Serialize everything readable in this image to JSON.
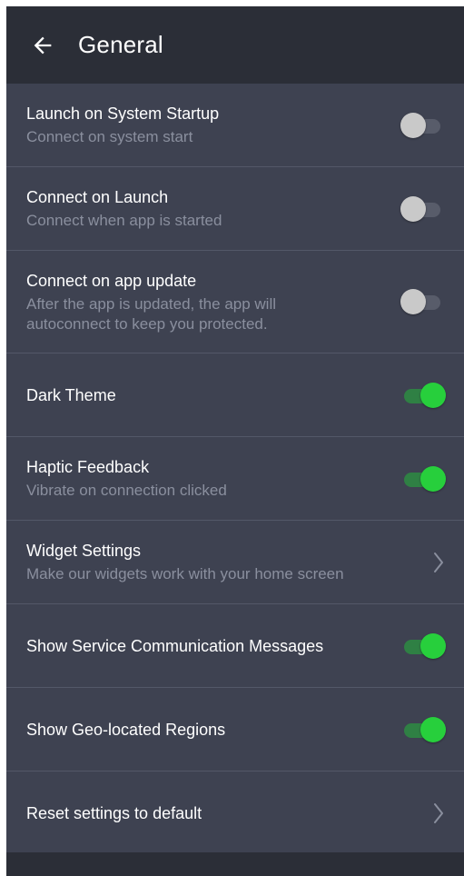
{
  "header": {
    "title": "General",
    "back_icon": "arrow-left-icon"
  },
  "colors": {
    "background": "#2b2e37",
    "list_background": "#3e4251",
    "divider": "#535868",
    "toggle_on": "#27cf3c",
    "toggle_off": "#c9c9c9",
    "subtitle_text": "#8a8f9e"
  },
  "settings": [
    {
      "title": "Launch on System Startup",
      "subtitle": "Connect on system start",
      "control": "toggle",
      "enabled": false
    },
    {
      "title": "Connect on Launch",
      "subtitle": "Connect when app is started",
      "control": "toggle",
      "enabled": false
    },
    {
      "title": "Connect on app update",
      "subtitle": "After the app is updated, the app will autoconnect to keep you protected.",
      "control": "toggle",
      "enabled": false
    },
    {
      "title": "Dark Theme",
      "control": "toggle",
      "enabled": true
    },
    {
      "title": "Haptic Feedback",
      "subtitle": "Vibrate on connection clicked",
      "control": "toggle",
      "enabled": true
    },
    {
      "title": "Widget Settings",
      "subtitle": "Make our widgets work with your home screen",
      "control": "chevron",
      "icon": "chevron-right-icon"
    },
    {
      "title": "Show Service Communication Messages",
      "control": "toggle",
      "enabled": true
    },
    {
      "title": "Show Geo-located Regions",
      "control": "toggle",
      "enabled": true
    },
    {
      "title": "Reset settings to default",
      "control": "chevron",
      "icon": "chevron-right-icon"
    }
  ]
}
